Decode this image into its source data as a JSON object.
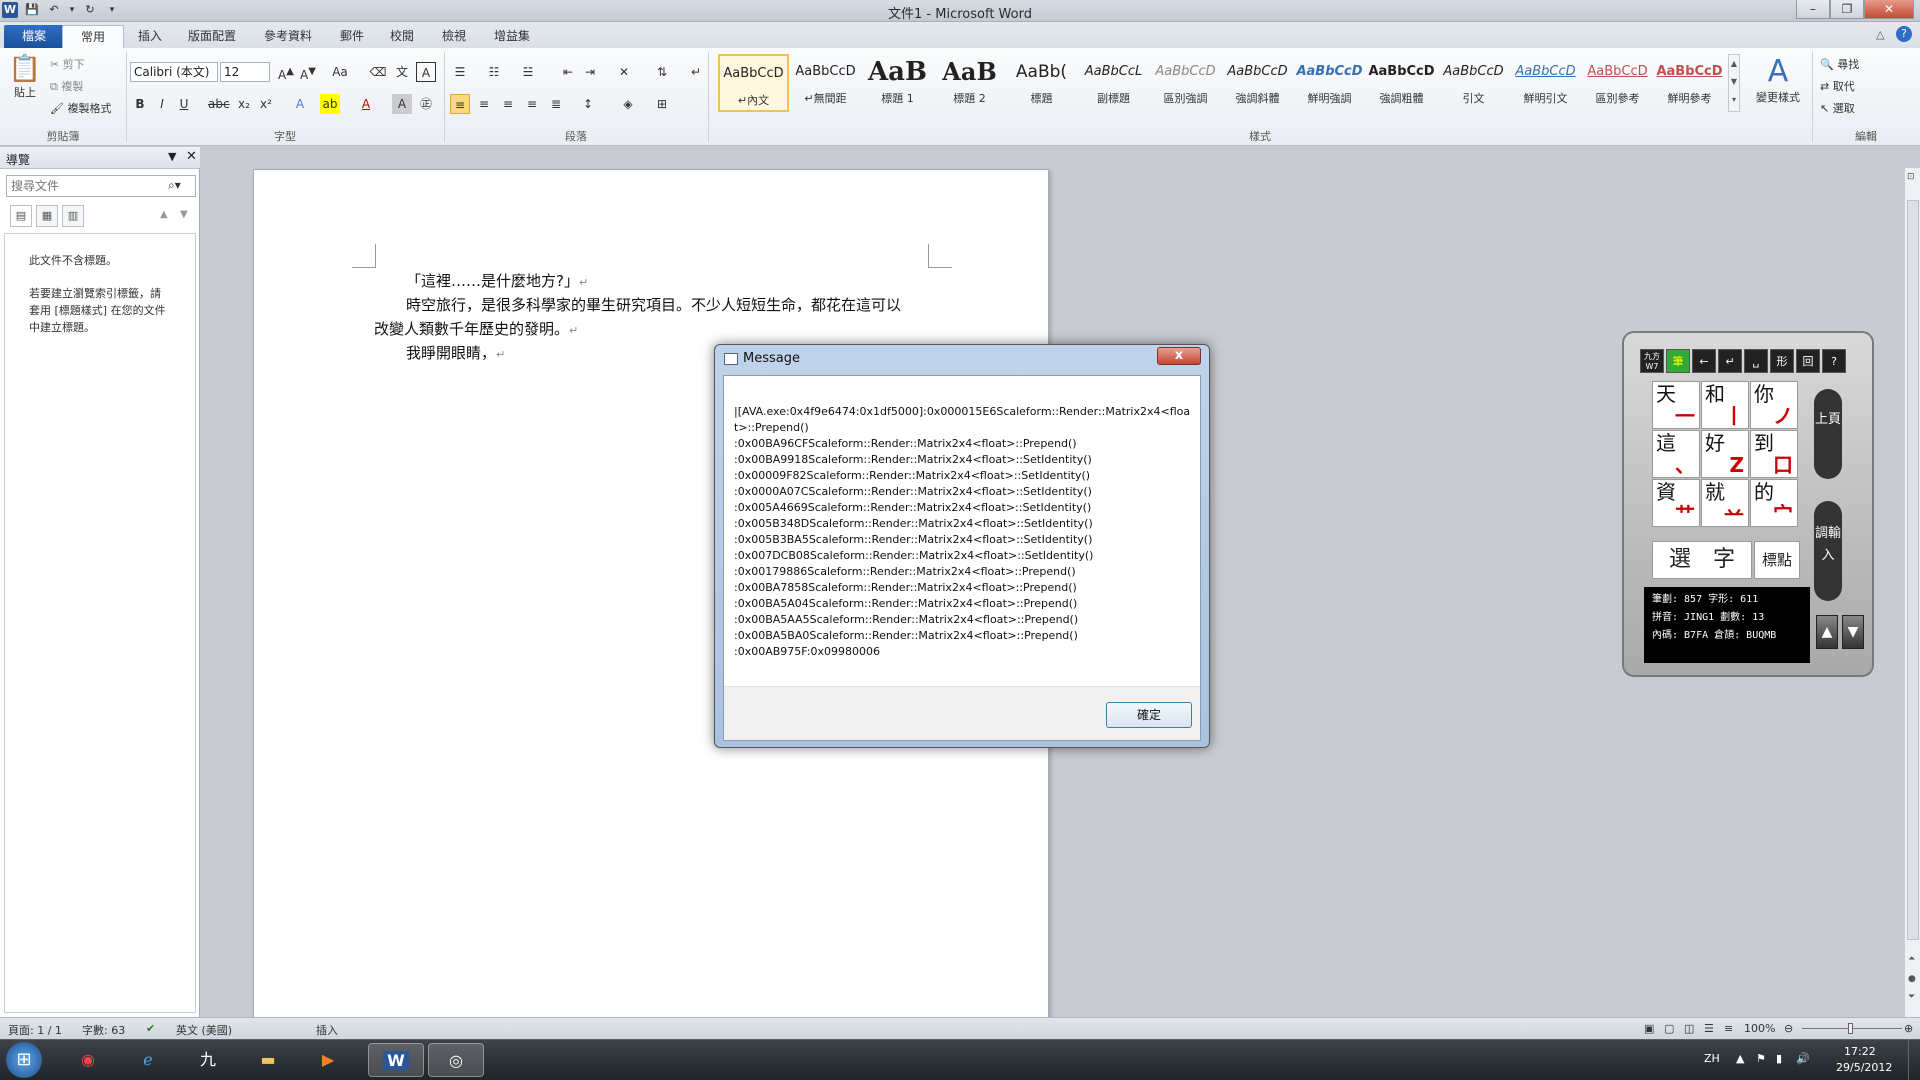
{
  "window": {
    "title": "文件1 - Microsoft Word"
  },
  "tabs": [
    {
      "label": "檔案"
    },
    {
      "label": "常用"
    },
    {
      "label": "插入"
    },
    {
      "label": "版面配置"
    },
    {
      "label": "參考資料"
    },
    {
      "label": "郵件"
    },
    {
      "label": "校閱"
    },
    {
      "label": "檢視"
    },
    {
      "label": "增益集"
    }
  ],
  "ribbon": {
    "clipboard": {
      "paste": "貼上",
      "cut": "剪下",
      "copy": "複製",
      "format_painter": "複製格式",
      "label": "剪貼簿"
    },
    "font": {
      "name": "Calibri (本文)",
      "size": "12",
      "label": "字型"
    },
    "paragraph": {
      "label": "段落"
    },
    "styles": {
      "label": "樣式",
      "items": [
        {
          "sample": "AaBbCcD",
          "name": "↵內文"
        },
        {
          "sample": "AaBbCcD",
          "name": "↵無間距"
        },
        {
          "sample": "AaB",
          "name": "標題 1"
        },
        {
          "sample": "AaB",
          "name": "標題 2"
        },
        {
          "sample": "AaBb(",
          "name": "標題"
        },
        {
          "sample": "AaBbCcL",
          "name": "副標題"
        },
        {
          "sample": "AaBbCcD",
          "name": "區別強調"
        },
        {
          "sample": "AaBbCcD",
          "name": "強調斜體"
        },
        {
          "sample": "AaBbCcD",
          "name": "鮮明強調"
        },
        {
          "sample": "AaBbCcD",
          "name": "強調粗體"
        },
        {
          "sample": "AaBbCcD",
          "name": "引文"
        },
        {
          "sample": "AaBbCcD",
          "name": "鮮明引文"
        },
        {
          "sample": "AaBbCcD",
          "name": "區別參考"
        },
        {
          "sample": "AaBbCcD",
          "name": "鮮明參考"
        }
      ],
      "change_styles": "變更樣式"
    },
    "editing": {
      "find": "尋找",
      "replace": "取代",
      "select": "選取",
      "label": "編輯"
    }
  },
  "nav": {
    "title": "導覽",
    "search_placeholder": "搜尋文件",
    "no_headings": "此文件不含標題。",
    "hint": "若要建立瀏覽索引標籤，請套用 [標題樣式] 在您的文件中建立標題。"
  },
  "document": {
    "lines": [
      "「這裡……是什麼地方?」",
      "時空旅行，是很多科學家的畢生研究項目。不少人短短生命，都花在這可以",
      "改變人類數千年歷史的發明。",
      "我睜開眼睛，"
    ],
    "para_mark": "↵"
  },
  "dialog": {
    "title": "Message",
    "close": "x",
    "message": "|[AVA.exe:0x4f9e6474:0x1df5000]:0x000015E6Scaleform::Render::Matrix2x4<float>::Prepend()\n:0x00BA96CFScaleform::Render::Matrix2x4<float>::Prepend()\n:0x00BA9918Scaleform::Render::Matrix2x4<float>::SetIdentity()\n:0x00009F82Scaleform::Render::Matrix2x4<float>::SetIdentity()\n:0x0000A07CScaleform::Render::Matrix2x4<float>::SetIdentity()\n:0x005A4669Scaleform::Render::Matrix2x4<float>::SetIdentity()\n:0x005B348DScaleform::Render::Matrix2x4<float>::SetIdentity()\n:0x005B3BA5Scaleform::Render::Matrix2x4<float>::SetIdentity()\n:0x007DCB08Scaleform::Render::Matrix2x4<float>::SetIdentity()\n:0x00179886Scaleform::Render::Matrix2x4<float>::Prepend()\n:0x00BA7858Scaleform::Render::Matrix2x4<float>::Prepend()\n:0x00BA5A04Scaleform::Render::Matrix2x4<float>::Prepend()\n:0x00BA5AA5Scaleform::Render::Matrix2x4<float>::Prepend()\n:0x00BA5BA0Scaleform::Render::Matrix2x4<float>::Prepend()\n:0x00AB975F:0x09980006",
    "ok": "確定"
  },
  "ime": {
    "top": [
      "九方W7",
      "筆",
      "←",
      "↵",
      "␣",
      "形",
      "回",
      "?"
    ],
    "cells": [
      {
        "ch": "天",
        "stroke": "一"
      },
      {
        "ch": "和",
        "stroke": "丨"
      },
      {
        "ch": "你",
        "stroke": "ノ"
      },
      {
        "ch": "這",
        "stroke": "、"
      },
      {
        "ch": "好",
        "stroke": "Z"
      },
      {
        "ch": "到",
        "stroke": "口"
      },
      {
        "ch": "資",
        "stroke": "艹"
      },
      {
        "ch": "就",
        "stroke": "䒑"
      },
      {
        "ch": "的",
        "stroke": "宀"
      }
    ],
    "select_label": "選　字",
    "punct_label": "標點",
    "prev_page": "上頁",
    "adjust_input": "調輸入",
    "info": [
      "筆劃: 857 字形: 611",
      "拼音: JING1 劃數: 13",
      "內碼: B7FA 倉頡: BUQMB"
    ]
  },
  "status": {
    "page": "頁面: 1 / 1",
    "words": "字數: 63",
    "lang": "英文 (美國)",
    "mode": "插入",
    "zoom": "100%"
  },
  "taskbar": {
    "lang": "ZH",
    "time": "17:22",
    "date": "29/5/2012"
  }
}
